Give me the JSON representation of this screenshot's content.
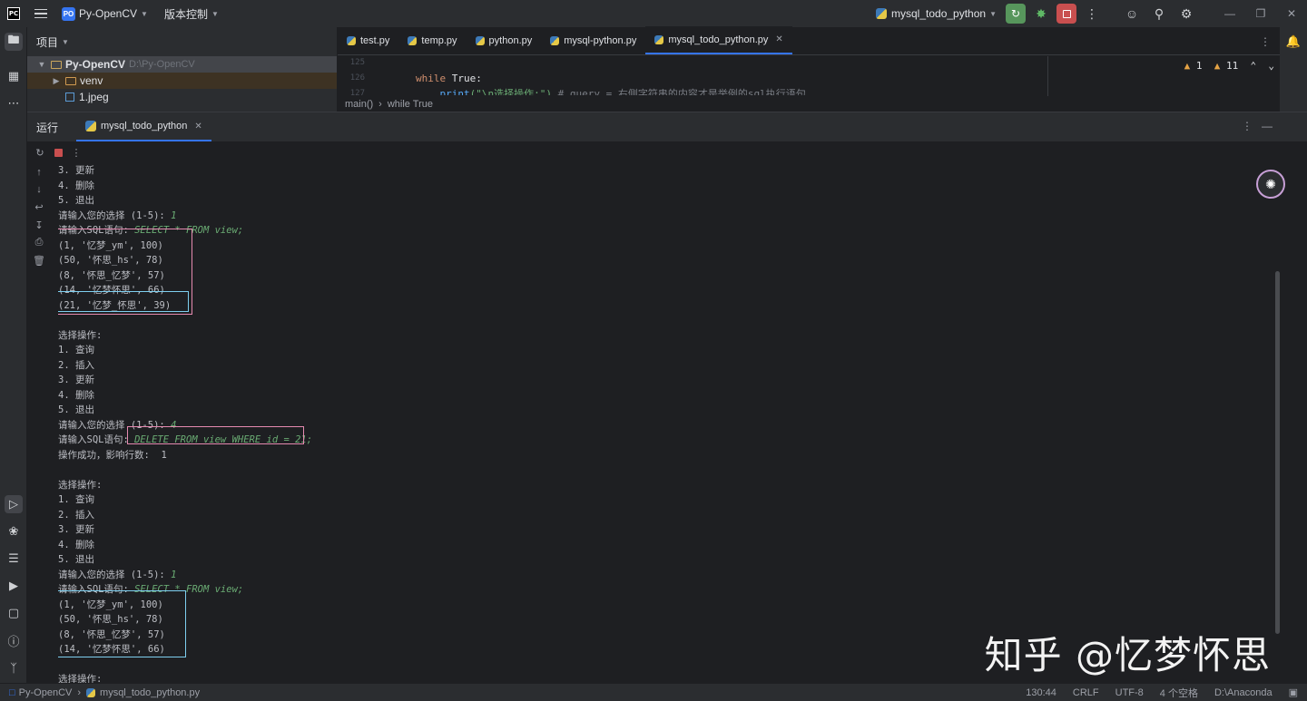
{
  "titlebar": {
    "logo": "PC",
    "project_badge": "PO",
    "project_name": "Py-OpenCV",
    "vcs_label": "版本控制",
    "run_config": "mysql_todo_python"
  },
  "project_panel": {
    "header": "项目",
    "root_name": "Py-OpenCV",
    "root_path": "D:\\Py-OpenCV",
    "items": [
      {
        "label": "venv"
      },
      {
        "label": "1.jpeg"
      }
    ]
  },
  "editor": {
    "tabs": [
      {
        "label": "test.py"
      },
      {
        "label": "temp.py"
      },
      {
        "label": "python.py"
      },
      {
        "label": "mysql-python.py"
      },
      {
        "label": "mysql_todo_python.py"
      }
    ],
    "line_numbers": [
      "125",
      "126",
      "127"
    ],
    "code": {
      "line1_kw": "while",
      "line1_rest": " True:",
      "line2_fn": "print",
      "line2_str": "(\"\\n选择操作:\")",
      "line2_cmt": " # query = 右侧字符串的内容才是举例的sql执行语句"
    },
    "inspections": {
      "warnings": "1",
      "weak": "11"
    },
    "breadcrumb": [
      "main()",
      "while True"
    ]
  },
  "run_panel": {
    "title": "运行",
    "tab": "mysql_todo_python"
  },
  "console": {
    "lines": [
      {
        "t": "3. 更新"
      },
      {
        "t": "4. 删除"
      },
      {
        "t": "5. 退出"
      },
      {
        "t": "请输入您的选择 (1-5): ",
        "in": "1"
      },
      {
        "t": "请输入SQL语句: ",
        "in_it": "SELECT * FROM view;"
      },
      {
        "t": "(1, '忆梦_ym', 100)"
      },
      {
        "t": "(50, '怀思_hs', 78)"
      },
      {
        "t": "(8, '怀思_忆梦', 57)"
      },
      {
        "t": "(14, '忆梦怀思', 66)"
      },
      {
        "t": "(21, '忆梦_怀思', 39)"
      },
      {
        "t": ""
      },
      {
        "t": "选择操作:"
      },
      {
        "t": "1. 查询"
      },
      {
        "t": "2. 插入"
      },
      {
        "t": "3. 更新"
      },
      {
        "t": "4. 删除"
      },
      {
        "t": "5. 退出"
      },
      {
        "t": "请输入您的选择 (1-5): ",
        "in": "4"
      },
      {
        "t": "请输入SQL语句: ",
        "in_it": "DELETE FROM view WHERE id = 21;"
      },
      {
        "t": "操作成功，影响行数:  1"
      },
      {
        "t": ""
      },
      {
        "t": "选择操作:"
      },
      {
        "t": "1. 查询"
      },
      {
        "t": "2. 插入"
      },
      {
        "t": "3. 更新"
      },
      {
        "t": "4. 删除"
      },
      {
        "t": "5. 退出"
      },
      {
        "t": "请输入您的选择 (1-5): ",
        "in": "1"
      },
      {
        "t": "请输入SQL语句: ",
        "in_it": "SELECT * FROM view;"
      },
      {
        "t": "(1, '忆梦_ym', 100)"
      },
      {
        "t": "(50, '怀思_hs', 78)"
      },
      {
        "t": "(8, '怀思_忆梦', 57)"
      },
      {
        "t": "(14, '忆梦怀思', 66)"
      },
      {
        "t": ""
      },
      {
        "t": "选择操作:"
      }
    ]
  },
  "watermark": "知乎 @忆梦怀思",
  "statusbar": {
    "project": "Py-OpenCV",
    "file": "mysql_todo_python.py",
    "position": "130:44",
    "line_sep": "CRLF",
    "encoding": "UTF-8",
    "indent": "4 个空格",
    "interpreter": "D:\\Anaconda"
  }
}
